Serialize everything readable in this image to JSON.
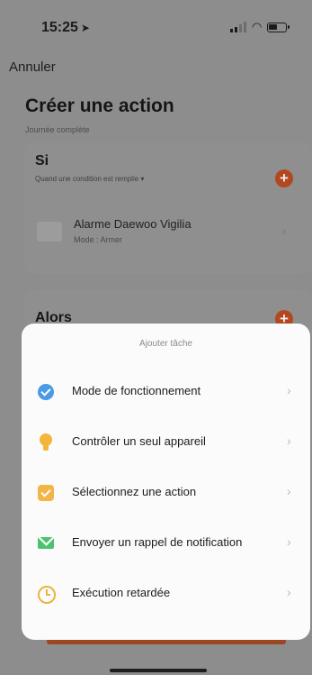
{
  "status_bar": {
    "time": "15:25",
    "location_arrow": "➤"
  },
  "nav": {
    "cancel_label": "Annuler"
  },
  "page": {
    "title": "Créer une action",
    "subtitle": "Journée complète"
  },
  "if_card": {
    "label": "Si",
    "condition_text": "Quand une condition est remplie ▾",
    "add_icon": "+",
    "device": {
      "name": "Alarme Daewoo Vigilia",
      "mode": "Mode : Armer",
      "chevron": "›"
    }
  },
  "then_card": {
    "label": "Alors",
    "add_icon": "+"
  },
  "sheet": {
    "title": "Ajouter tâche",
    "items": [
      {
        "label": "Mode de fonctionnement",
        "icon": "check-circle-icon",
        "color": "#4a9ae6",
        "chevron": "›"
      },
      {
        "label": "Contrôler un seul appareil",
        "icon": "lightbulb-icon",
        "color": "#f5b43a",
        "chevron": "›"
      },
      {
        "label": "Sélectionnez une action",
        "icon": "check-square-icon",
        "color": "#f3b548",
        "chevron": "›"
      },
      {
        "label": "Envoyer un rappel de notification",
        "icon": "mail-icon",
        "color": "#4fc271",
        "chevron": "›"
      },
      {
        "label": "Exécution retardée",
        "icon": "clock-icon",
        "color": "#e7b63d",
        "chevron": "›"
      }
    ]
  },
  "colors": {
    "accent": "#d9531f",
    "overlay": "#8d8d8d",
    "sheet_bg": "#fbfbfb"
  }
}
